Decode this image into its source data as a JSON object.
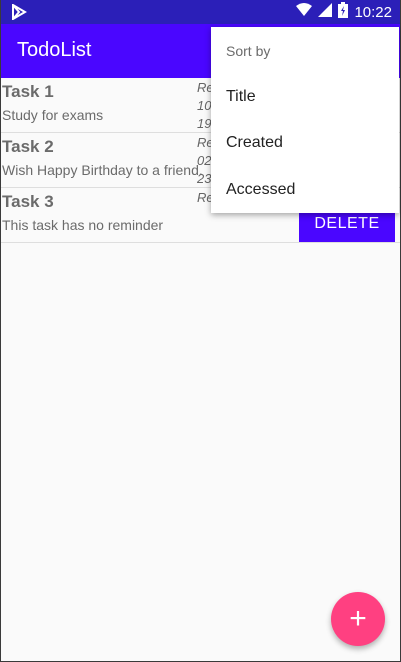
{
  "status_bar": {
    "time": "10:22",
    "icons": [
      "play-store-icon",
      "wifi-icon",
      "signal-icon",
      "battery-icon"
    ]
  },
  "app_bar": {
    "title": "TodoList"
  },
  "tasks": [
    {
      "title": "Task 1",
      "description": "Study for exams",
      "reminder_lines": [
        "Re",
        "10",
        "19"
      ]
    },
    {
      "title": "Task 2",
      "description": "Wish Happy Birthday to a friend.",
      "reminder_lines": [
        "Re",
        "02",
        "23"
      ]
    },
    {
      "title": "Task 3",
      "description": "This task has no reminder",
      "reminder_lines": [
        "Re"
      ]
    }
  ],
  "delete_button": {
    "label": "DELETE"
  },
  "sort_menu": {
    "header": "Sort by",
    "items": [
      "Title",
      "Created",
      "Accessed"
    ]
  },
  "fab": {
    "icon": "plus-icon",
    "label": "+"
  },
  "colors": {
    "primary": "#4a06ff",
    "status_bar": "#2b1fb8",
    "accent": "#ff4081"
  }
}
